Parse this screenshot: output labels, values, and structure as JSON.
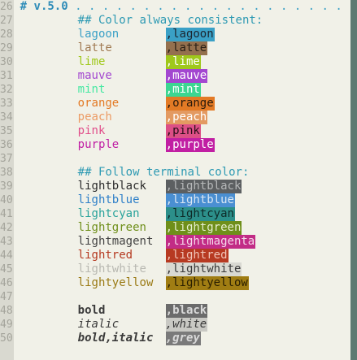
{
  "header": {
    "title": "# v.5.0",
    "dots": " . . . . . . . . . . . . . . . . . . . . . ."
  },
  "line_numbers": [
    "26",
    "27",
    "28",
    "29",
    "30",
    "31",
    "32",
    "33",
    "34",
    "35",
    "36",
    "37",
    "38",
    "39",
    "40",
    "41",
    "42",
    "43",
    "44",
    "45",
    "46",
    "47",
    "48",
    "49",
    "50"
  ],
  "comments": {
    "consistent": "## Color always consistent:",
    "terminal": "## Follow terminal color:"
  },
  "consistent_colors": [
    {
      "name": "lagoon",
      "code": ",lagoon",
      "color": "#3aa0c6",
      "bg": "#3aa0c6",
      "fg": "#1c2630"
    },
    {
      "name": "latte",
      "code": ",latte",
      "color": "#a07a52",
      "bg": "#94704e",
      "fg": "#2a2016"
    },
    {
      "name": "lime",
      "code": ",lime",
      "color": "#9fc81b",
      "bg": "#9fc81b",
      "fg": "#ffffff"
    },
    {
      "name": "mauve",
      "code": ",mauve",
      "color": "#a347d0",
      "bg": "#a347d0",
      "fg": "#ffffff"
    },
    {
      "name": "mint",
      "code": ",mint",
      "color": "#46e8a2",
      "bg": "#3cd692",
      "fg": "#ffffff"
    },
    {
      "name": "orange",
      "code": ",orange",
      "color": "#e37a25",
      "bg": "#e37a25",
      "fg": "#2a1a0c"
    },
    {
      "name": "peach",
      "code": ",peach",
      "color": "#ec9c66",
      "bg": "#e39a62",
      "fg": "#ffffff"
    },
    {
      "name": "pink",
      "code": ",pink",
      "color": "#e14f8a",
      "bg": "#dc4f86",
      "fg": "#2a0f18"
    },
    {
      "name": "purple",
      "code": ",purple",
      "color": "#c01ea4",
      "bg": "#c11fa3",
      "fg": "#ffffff"
    }
  ],
  "terminal_colors": [
    {
      "name": "lightblack",
      "code": ",lightblack",
      "color": "#2b2b2b",
      "bg": "#5c5f61",
      "fg": "#b6b8b9"
    },
    {
      "name": "lightblue",
      "code": ",lightblue",
      "color": "#2e7fc8",
      "bg": "#4a8fd2",
      "fg": "#dbe7f4"
    },
    {
      "name": "lightcyan",
      "code": ",lightcyan",
      "color": "#2aa39b",
      "bg": "#2c8f8a",
      "fg": "#0e2a28"
    },
    {
      "name": "lightgreen",
      "code": ",lightgreen",
      "color": "#6f8f1a",
      "bg": "#6f8f1a",
      "fg": "#e6efcf"
    },
    {
      "name": "lightmagent",
      "code": ",lightmagenta",
      "color": "#444444",
      "bg": "#c22c86",
      "fg": "#f5d8ea"
    },
    {
      "name": "lightred",
      "code": ",lightred",
      "color": "#b53920",
      "bg": "#b73a22",
      "fg": "#f0c5b8"
    },
    {
      "name": "lightwhite",
      "code": ",lightwhite",
      "color": "#b9b9b2",
      "bg": "#d9d9d2",
      "fg": "#3a3a3a"
    },
    {
      "name": "lightyellow",
      "code": ",lightyellow",
      "color": "#9a7a14",
      "bg": "#a07d13",
      "fg": "#2a1f00"
    }
  ],
  "styles": [
    {
      "name": "bold",
      "code": ",black",
      "color": "#3a3a3a",
      "bg": "#6b6b6b",
      "fg": "#d9d9d9"
    },
    {
      "name": "italic",
      "code": ",white",
      "color": "#3a3a3a",
      "bg": "#c9c9c4",
      "fg": "#3a3a3a"
    },
    {
      "name": "bold,italic",
      "code": ",grey",
      "color": "#3a3a3a",
      "bg": "#7a7a7a",
      "fg": "#d9d9d9"
    }
  ]
}
